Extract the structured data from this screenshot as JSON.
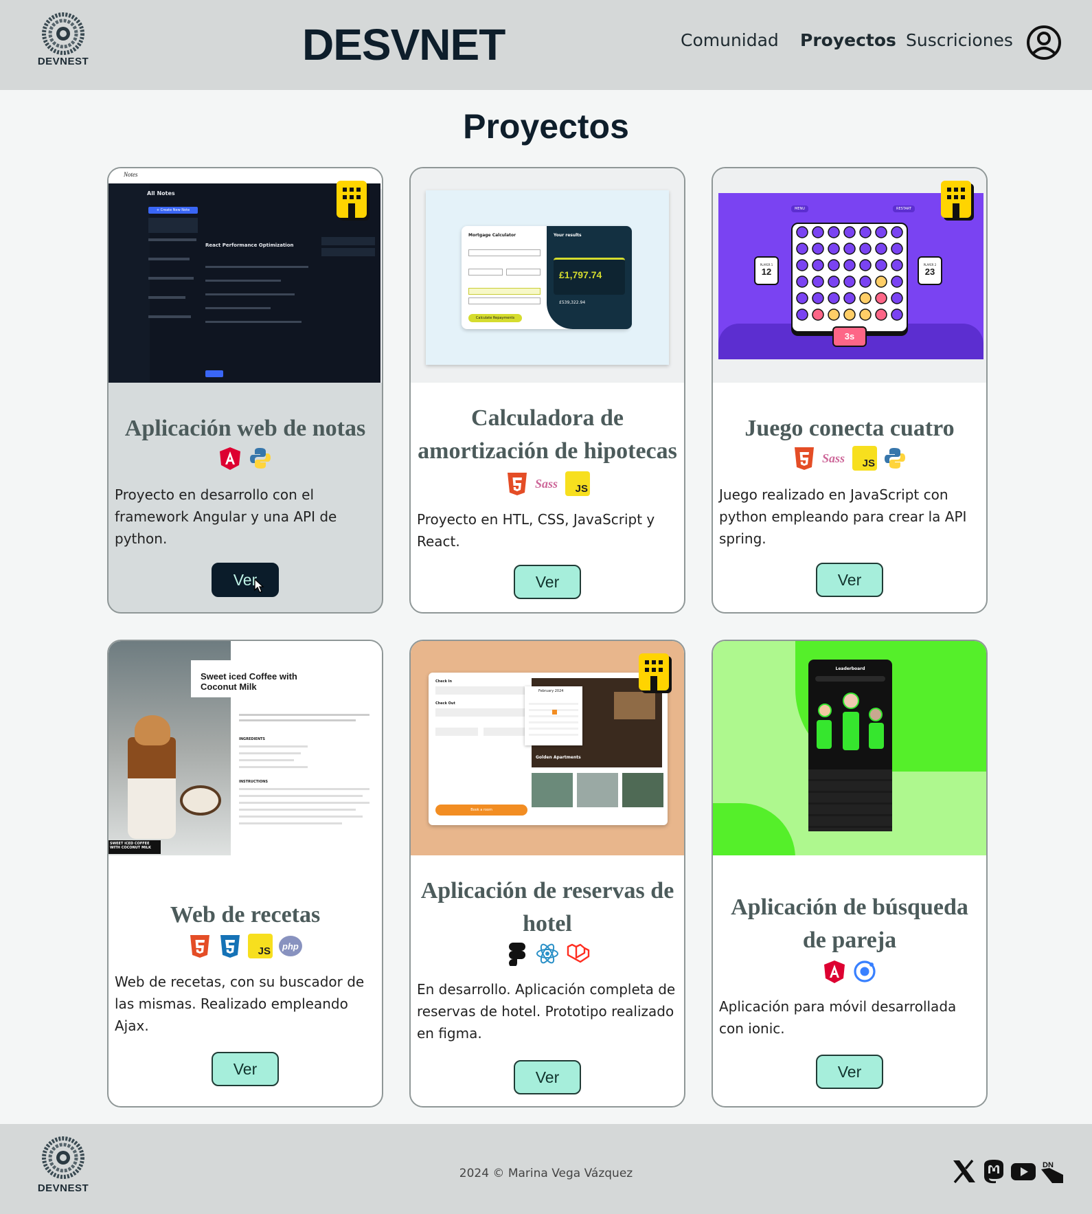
{
  "header": {
    "logo_text": "DEVNEST",
    "site_title": "DESVNET",
    "nav": [
      {
        "label": "Comunidad"
      },
      {
        "label": "Proyectos"
      },
      {
        "label": "Suscriciones"
      }
    ],
    "active_nav": "Proyectos",
    "user_icon": "user-circle-icon"
  },
  "main": {
    "page_title": "Proyectos",
    "projects": [
      {
        "title": "Aplicación web de notas",
        "techs": [
          "angular-icon",
          "python-icon"
        ],
        "description": "Proyecto en desarrollo con el framework Angular y una API de python.",
        "button": "Ver"
      },
      {
        "title": "Calculadora de amortización de hipotecas",
        "techs": [
          "html5-icon",
          "sass-icon",
          "js-icon"
        ],
        "description": "Proyecto en HTL, CSS, JavaScript y React.",
        "button": "Ver",
        "preview": {
          "panel_title": "Mortgage Calculator",
          "results_title": "Your results",
          "amount": "£1,797.74",
          "total": "£539,322.94",
          "cta": "Calculate Repayments"
        }
      },
      {
        "title": "Juego conecta cuatro",
        "techs": [
          "html5-icon",
          "sass-icon",
          "js-icon",
          "python-icon"
        ],
        "description": "Juego realizado en JavaScript con python empleando para crear la API spring.",
        "button": "Ver",
        "preview": {
          "player1": "PLAYER 1",
          "score1": "12",
          "player2": "PLAYER 2",
          "score2": "23",
          "timer": "3s",
          "menu": "MENU",
          "restart": "RESTART"
        }
      },
      {
        "title": "Web de recetas",
        "techs": [
          "html5-icon",
          "css3-icon",
          "js-icon",
          "php-icon"
        ],
        "description": "Web de recetas, con su buscador de las mismas. Realizado empleando Ajax.",
        "button": "Ver",
        "preview": {
          "recipe_title": "Sweet iced Coffee with Coconut Milk",
          "caption": "SWEET ICED COFFEE WITH COCONUT MILK",
          "ingredients": "INGREDIENTS",
          "instructions": "INSTRUCTIONS"
        }
      },
      {
        "title": "Aplicación de reservas de hotel",
        "techs": [
          "figma-icon",
          "react-icon",
          "laravel-icon"
        ],
        "description": "En desarrollo. Aplicación completa de reservas de hotel. Prototipo realizado en figma.",
        "button": "Ver",
        "preview": {
          "check_in": "Check In",
          "check_out": "Check Out",
          "month": "February 2024",
          "hotel": "Golden Apartments",
          "cta": "Book a room"
        }
      },
      {
        "title": "Aplicación de búsqueda de pareja",
        "techs": [
          "angular-icon",
          "ionic-icon"
        ],
        "description": "Aplicación para móvil desarrollada con ionic.",
        "button": "Ver",
        "preview": {
          "screen_title": "Leaderboard"
        }
      }
    ],
    "notes_preview": {
      "app": "Notes",
      "heading": "All Notes",
      "note_title": "React Performance Optimization",
      "new_button": "+ Create New Note"
    }
  },
  "footer": {
    "logo_text": "DEVNEST",
    "copyright": "2024 © Marina Vega Vázquez",
    "social": [
      "x-icon",
      "mastodon-icon",
      "youtube-icon",
      "devnest-icon"
    ]
  },
  "colors": {
    "header_bg": "#d5d8d8",
    "button_bg": "#a6eedb",
    "button_active_bg": "#0b1c2a",
    "title_color": "#0e1e2b",
    "card_title_color": "#4c5b5b"
  }
}
